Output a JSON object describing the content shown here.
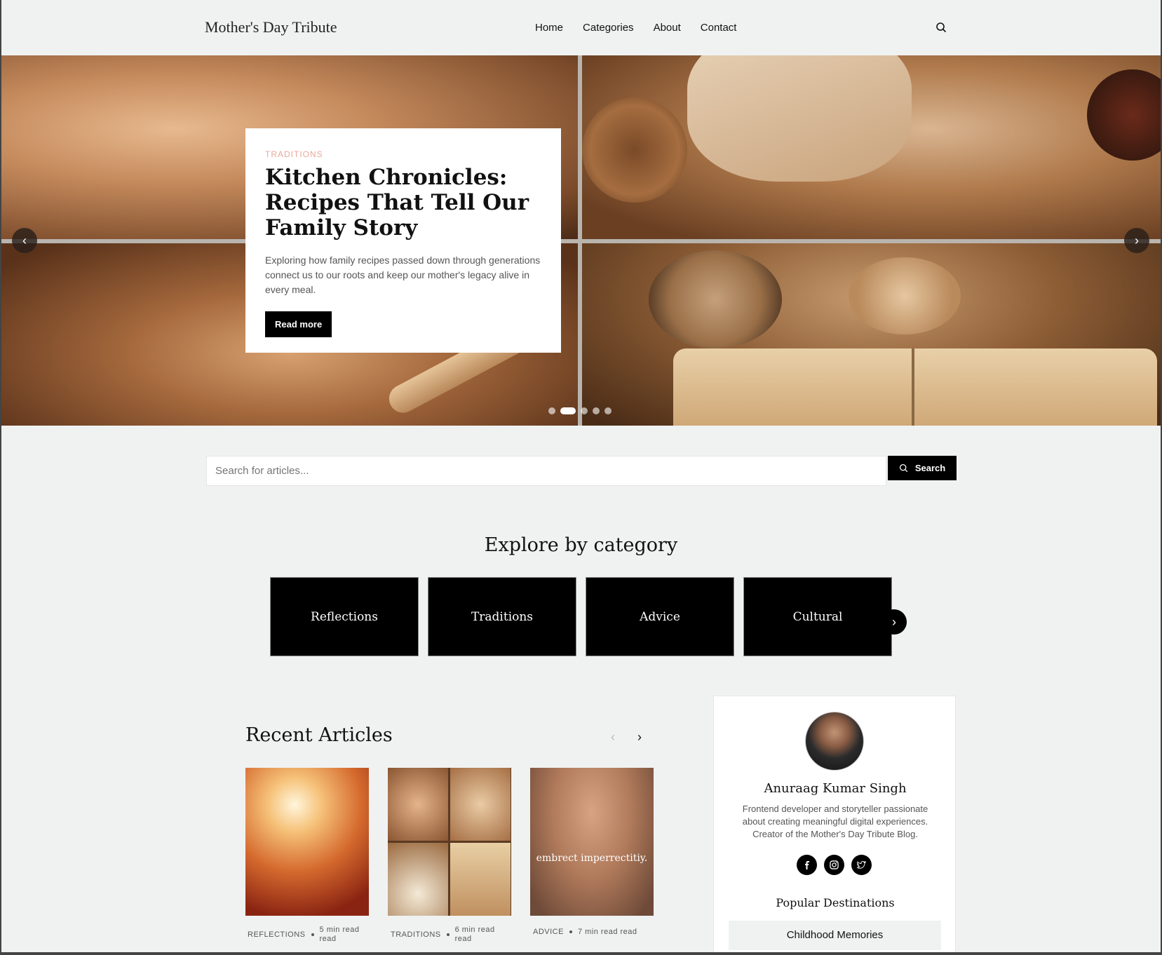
{
  "header": {
    "logo": "Mother's Day Tribute",
    "nav": [
      "Home",
      "Categories",
      "About",
      "Contact"
    ]
  },
  "hero": {
    "tag": "TRADITIONS",
    "title": "Kitchen Chronicles: Recipes That Tell Our Family Story",
    "excerpt": "Exploring how family recipes passed down through generations connect us to our roots and keep our mother's legacy alive in every meal.",
    "button": "Read more",
    "prev": "‹",
    "next": "›",
    "dots_total": 5,
    "dots_active": 2
  },
  "search": {
    "placeholder": "Search for articles...",
    "button": "Search"
  },
  "categories": {
    "title": "Explore by category",
    "items": [
      "Reflections",
      "Traditions",
      "Advice",
      "Cultural"
    ],
    "next": "›"
  },
  "recent": {
    "title": "Recent Articles",
    "prev": "‹",
    "next": "›",
    "articles": [
      {
        "category": "REFLECTIONS",
        "read": "5 min read read"
      },
      {
        "category": "TRADITIONS",
        "read": "6 min read read"
      },
      {
        "category": "ADVICE",
        "read": "7 min read read",
        "image_text": "embrect imperrectitiy."
      }
    ]
  },
  "sidebar": {
    "author": "Anuraag Kumar Singh",
    "bio": "Frontend developer and storyteller passionate about creating meaningful digital experiences. Creator of the Mother's Day Tribute Blog.",
    "socials": [
      "facebook-icon",
      "instagram-icon",
      "twitter-icon"
    ],
    "popular_title": "Popular Destinations",
    "popular_items": [
      "Childhood Memories"
    ]
  }
}
